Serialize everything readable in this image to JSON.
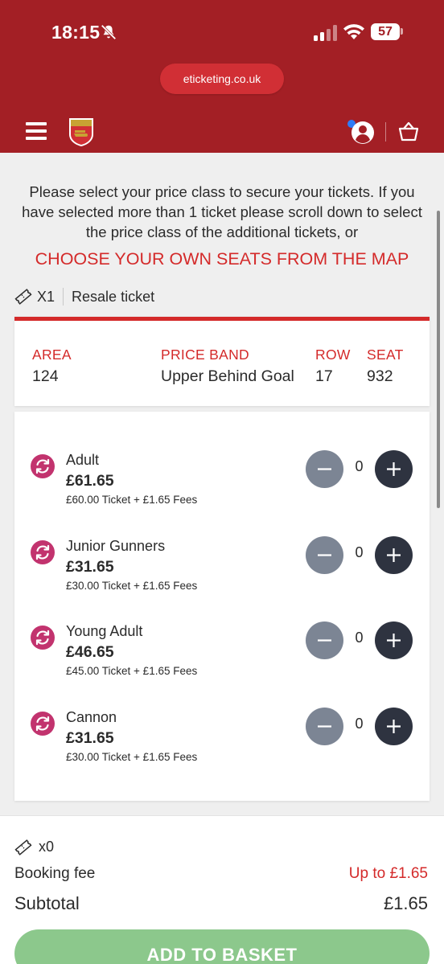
{
  "status_bar": {
    "time": "18:15",
    "battery": "57"
  },
  "browser": {
    "url": "eticketing.co.uk"
  },
  "intro_text": "Please select your price class to secure your tickets. If you have selected more than 1 ticket please scroll down to select the price class of the additional tickets, or",
  "choose_seats_link": "CHOOSE YOUR OWN SEATS FROM THE MAP",
  "ticket_info": {
    "count": "X1",
    "type": "Resale ticket"
  },
  "seat": {
    "area_label": "AREA",
    "area": "124",
    "price_band_label": "PRICE BAND",
    "price_band": "Upper Behind Goal",
    "row_label": "ROW",
    "row": "17",
    "seat_label": "SEAT",
    "seat": "932"
  },
  "price_classes": [
    {
      "name": "Adult",
      "price": "£61.65",
      "breakdown": "£60.00 Ticket + £1.65 Fees",
      "qty": "0"
    },
    {
      "name": "Junior Gunners",
      "price": "£31.65",
      "breakdown": "£30.00 Ticket + £1.65 Fees",
      "qty": "0"
    },
    {
      "name": "Young Adult",
      "price": "£46.65",
      "breakdown": "£45.00 Ticket + £1.65 Fees",
      "qty": "0"
    },
    {
      "name": "Cannon",
      "price": "£31.65",
      "breakdown": "£30.00 Ticket + £1.65 Fees",
      "qty": "0"
    }
  ],
  "footer": {
    "ticket_count": "x0",
    "booking_fee_label": "Booking fee",
    "booking_fee_value": "Up to £1.65",
    "subtotal_label": "Subtotal",
    "subtotal_value": "£1.65",
    "add_button": "ADD TO BASKET"
  },
  "colors": {
    "brand_red": "#a31f25",
    "accent_red": "#d42a2a",
    "button_green": "#8cc88c",
    "plus_button": "#2e3340",
    "minus_button": "#7c8594",
    "resale_icon": "#c2336e"
  }
}
